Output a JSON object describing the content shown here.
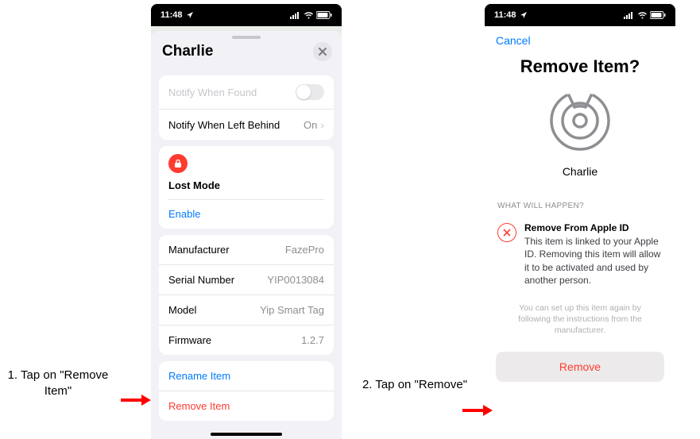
{
  "status": {
    "time": "11:48",
    "location_arrow": "➤"
  },
  "phone1": {
    "title": "Charlie",
    "notify_found": "Notify When Found",
    "notify_left": "Notify When Left Behind",
    "on": "On",
    "lost_mode": "Lost Mode",
    "enable": "Enable",
    "info": {
      "manufacturer_label": "Manufacturer",
      "manufacturer_value": "FazePro",
      "serial_label": "Serial Number",
      "serial_value": "YIP0013084",
      "model_label": "Model",
      "model_value": "Yip Smart Tag",
      "firmware_label": "Firmware",
      "firmware_value": "1.2.7"
    },
    "rename": "Rename Item",
    "remove": "Remove Item"
  },
  "phone2": {
    "cancel": "Cancel",
    "title": "Remove Item?",
    "item_name": "Charlie",
    "section": "WHAT WILL HAPPEN?",
    "info_title": "Remove From Apple ID",
    "info_body": "This item is linked to your Apple ID. Removing this item will allow it to be activated and used by another person.",
    "footnote": "You can set up this item again by following the instructions from the manufacturer.",
    "remove_btn": "Remove"
  },
  "annotations": {
    "step1": "1. Tap on \"Remove Item\"",
    "step2": "2. Tap on \"Remove\""
  }
}
